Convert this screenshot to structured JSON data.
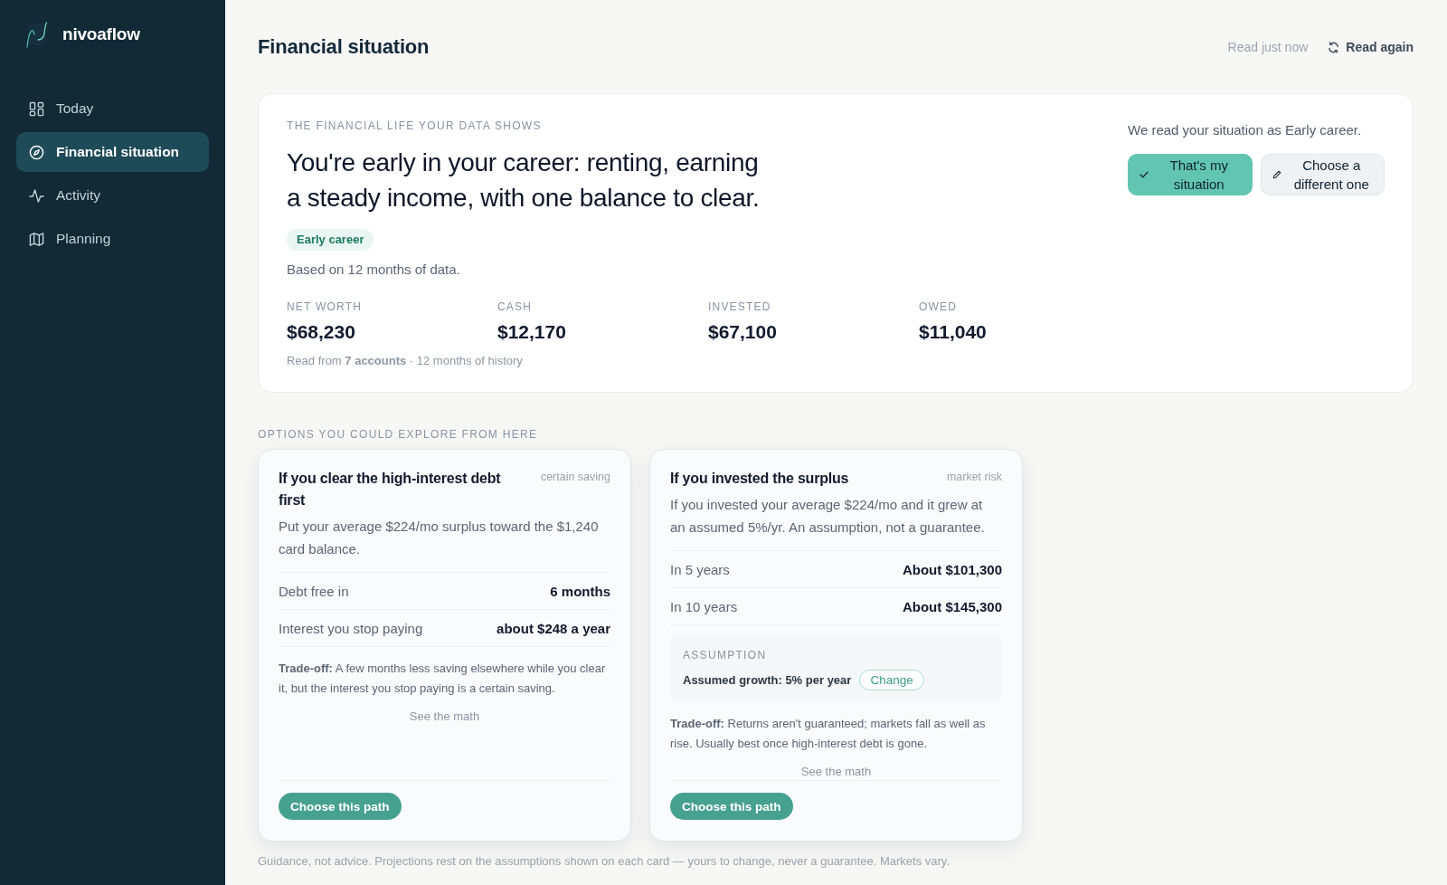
{
  "sidebar": {
    "brand": "nivoaflow",
    "items": [
      {
        "label": "Today",
        "selected": false
      },
      {
        "label": "Financial situation",
        "selected": true
      },
      {
        "label": "Activity",
        "selected": false
      },
      {
        "label": "Planning",
        "selected": false
      }
    ]
  },
  "header": {
    "title": "Financial situation",
    "status": "Read just now",
    "action": "Read again"
  },
  "summary": {
    "eyebrow": "THE FINANCIAL LIFE YOUR DATA SHOWS",
    "headline": "You're early in your career: renting, earning a steady income, with one balance to clear.",
    "tag": "Early career",
    "basis": "Based on 12 months of data.",
    "stats": [
      {
        "label": "NET WORTH",
        "value": "$68,230"
      },
      {
        "label": "CASH",
        "value": "$12,170"
      },
      {
        "label": "INVESTED",
        "value": "$67,100"
      },
      {
        "label": "OWED",
        "value": "$11,040"
      }
    ],
    "source": "Read from **7 accounts** · 12 months of history",
    "prompt": "We read your situation as Early career.",
    "buttons": [
      {
        "label": "That's my situation",
        "kind": "confirm"
      },
      {
        "label": "Choose a different one",
        "kind": "edit"
      }
    ]
  },
  "options": {
    "heading": "OPTIONS YOU COULD EXPLORE FROM HERE",
    "cards": [
      {
        "title": "If you clear the high-interest debt first",
        "tag": "certain saving",
        "description": "Put your average $224/mo surplus toward the $1,240 card balance.",
        "rows": [
          {
            "label": "Debt free in",
            "value": "6 months"
          },
          {
            "label": "Interest you stop paying",
            "value": "about $248 a year"
          }
        ],
        "tradeoff": "**Trade-off:** A few months less saving elsewhere while you clear it, but the interest you stop paying is a certain saving.",
        "link": "See the math",
        "button": "Choose this path"
      },
      {
        "title": "If you invested the surplus",
        "tag": "market risk",
        "description": "If you invested your average $224/mo and it grew at an assumed 5%/yr. An assumption, not a guarantee.",
        "rows": [
          {
            "label": "In 5 years",
            "value": "About $101,300"
          },
          {
            "label": "In 10 years",
            "value": "About $145,300"
          }
        ],
        "assumption": {
          "heading": "ASSUMPTION",
          "text": "Assumed growth: 5% per year",
          "action": "Change"
        },
        "tradeoff": "**Trade-off:** Returns aren't guaranteed; markets fall as well as rise. Usually best once high-interest debt is gone.",
        "link": "See the math",
        "button": "Choose this path"
      }
    ]
  },
  "footer": "Guidance, not advice. Projections rest on the assumptions shown on each card — yours to change, never a guarantee. Markets vary."
}
